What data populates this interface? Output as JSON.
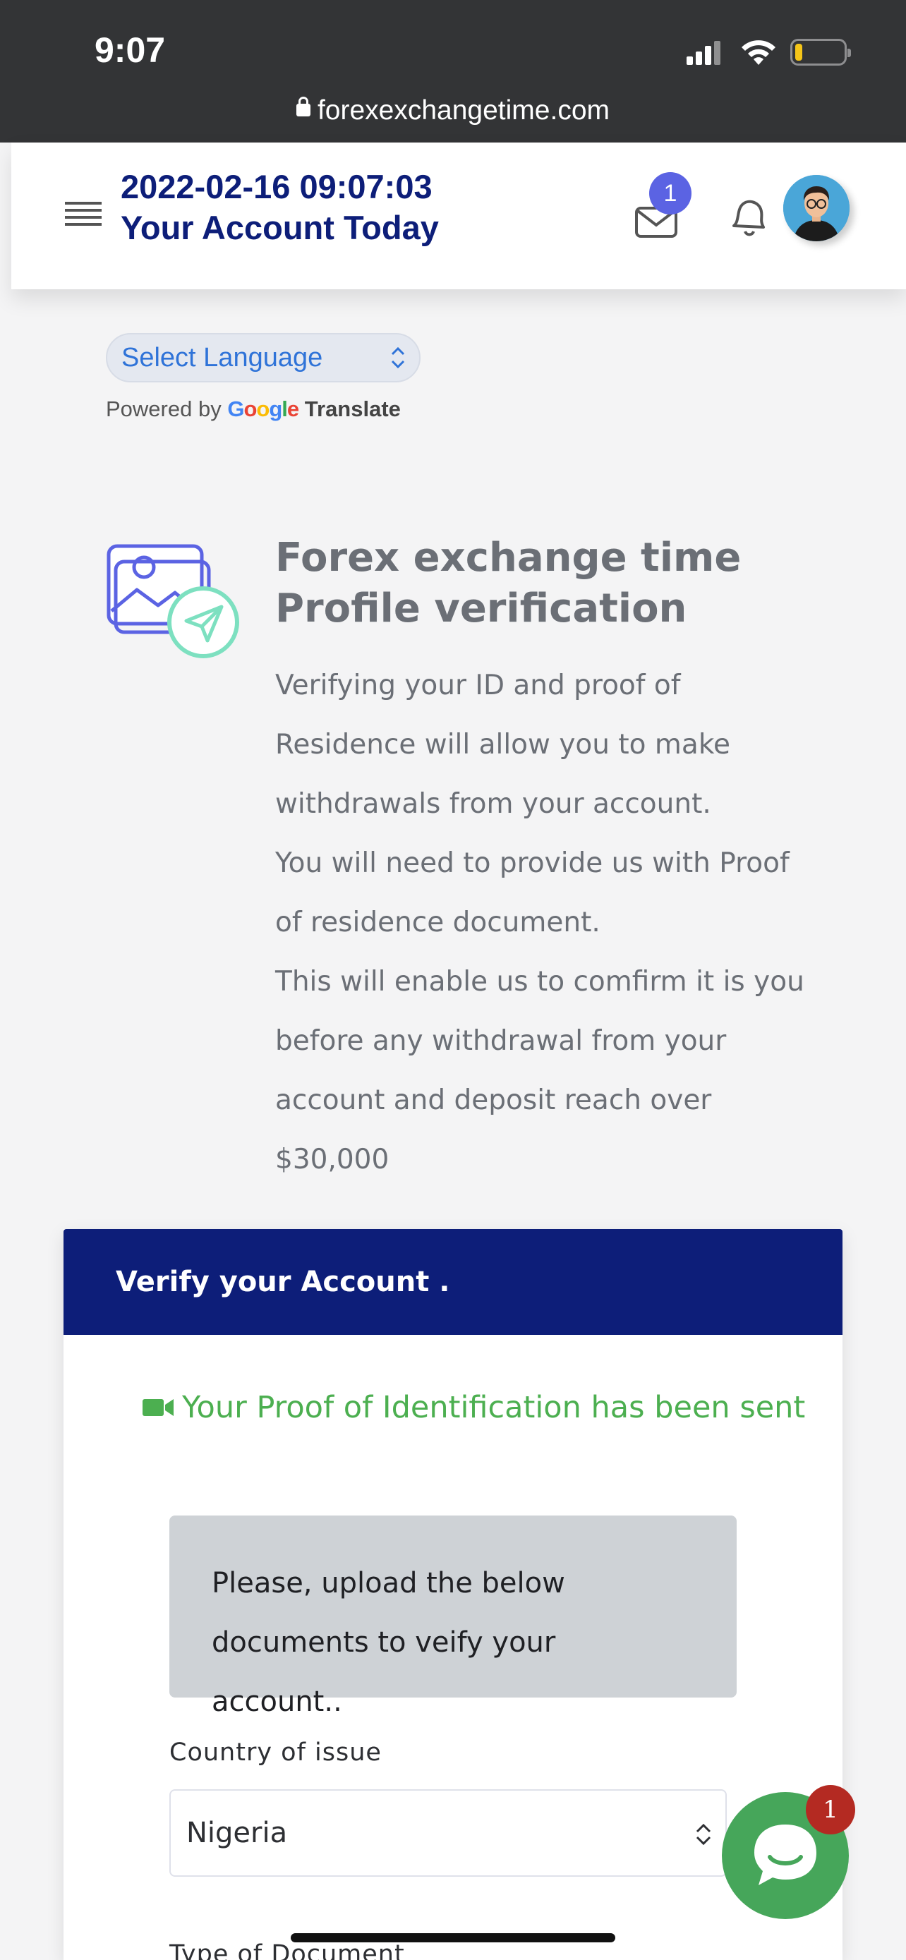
{
  "status_bar": {
    "time": "9:07",
    "url": "forexexchangetime.com"
  },
  "header": {
    "datetime": "2022-02-16 09:07:03",
    "title": "Your Account Today",
    "mail_badge_count": "1"
  },
  "language": {
    "select_label": "Select Language",
    "powered_by": "Powered by",
    "google_letters": [
      "G",
      "o",
      "o",
      "g",
      "l",
      "e"
    ],
    "translate": "Translate"
  },
  "profile_section": {
    "title_line1": "Forex exchange time",
    "title_line2": "Profile verification",
    "paragraph1": "Verifying your ID and proof of Residence will allow you to make withdrawals from your account.",
    "paragraph2": "You will need to provide us with Proof of residence document.",
    "paragraph3": "This will enable us to comfirm it is you before any withdrawal from your account and deposit reach over $30,000"
  },
  "verify_card": {
    "header": "Verify your Account .",
    "sent_message": "Your Proof of Identification has been sent",
    "notice_line1": "Please, upload the below",
    "notice_line2": "documents to veify your account..",
    "country_label": "Country of issue",
    "country_value": "Nigeria",
    "document_type_label": "Type of Document"
  },
  "chat": {
    "badge_count": "1"
  },
  "colors": {
    "navy": "#0d1e79",
    "success_green": "#4caf50",
    "chat_green": "#46a65a",
    "badge_blue": "#5b63e3",
    "badge_red": "#b42a22"
  }
}
